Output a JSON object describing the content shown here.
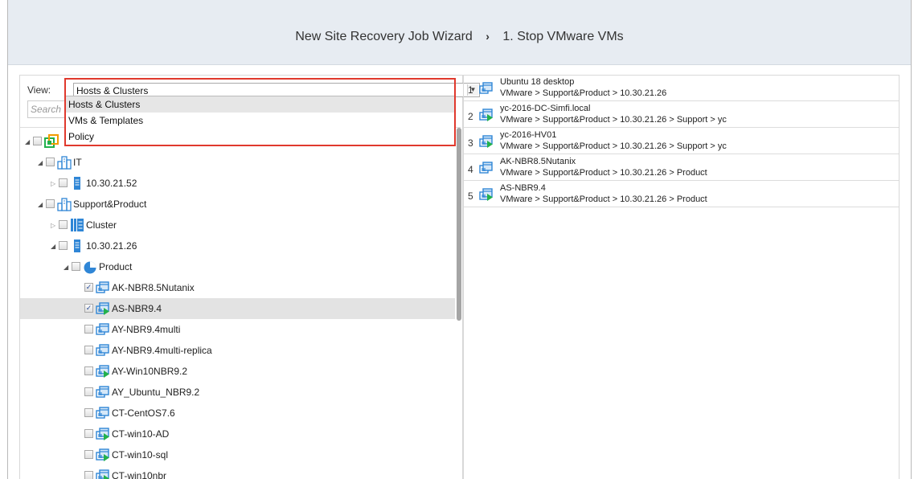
{
  "header": {
    "wizard_title": "New Site Recovery Job Wizard",
    "separator": "›",
    "step_title": "1. Stop VMware VMs"
  },
  "view": {
    "label": "View:",
    "selected": "Hosts & Clusters",
    "options": [
      "Hosts & Clusters",
      "VMs & Templates",
      "Policy"
    ]
  },
  "search": {
    "placeholder": "Search"
  },
  "tree": {
    "rows": [
      {
        "label": "",
        "icon": "vmware-root-icon",
        "twisty": "expanded",
        "checked": false
      },
      {
        "label": "IT",
        "icon": "folder-datacenter-icon",
        "twisty": "expanded",
        "checked": false
      },
      {
        "label": "10.30.21.52",
        "icon": "host-server-icon",
        "twisty": "collapsed",
        "checked": false
      },
      {
        "label": "Support&Product",
        "icon": "folder-datacenter-icon",
        "twisty": "expanded",
        "checked": false
      },
      {
        "label": "Cluster",
        "icon": "cluster-icon",
        "twisty": "collapsed",
        "checked": false
      },
      {
        "label": "10.30.21.26",
        "icon": "host-server-icon",
        "twisty": "expanded",
        "checked": false
      },
      {
        "label": "Product",
        "icon": "resource-pool-icon",
        "twisty": "expanded",
        "checked": false
      },
      {
        "label": "AK-NBR8.5Nutanix",
        "icon": "vm-icon",
        "twisty": "",
        "checked": true
      },
      {
        "label": "AS-NBR9.4",
        "icon": "vm-running-icon",
        "twisty": "",
        "checked": true
      },
      {
        "label": "AY-NBR9.4multi",
        "icon": "vm-icon",
        "twisty": "",
        "checked": false
      },
      {
        "label": "AY-NBR9.4multi-replica",
        "icon": "vm-icon",
        "twisty": "",
        "checked": false
      },
      {
        "label": "AY-Win10NBR9.2",
        "icon": "vm-running-icon",
        "twisty": "",
        "checked": false
      },
      {
        "label": "AY_Ubuntu_NBR9.2",
        "icon": "vm-icon",
        "twisty": "",
        "checked": false
      },
      {
        "label": "CT-CentOS7.6",
        "icon": "vm-icon",
        "twisty": "",
        "checked": false
      },
      {
        "label": "CT-win10-AD",
        "icon": "vm-running-icon",
        "twisty": "",
        "checked": false
      },
      {
        "label": "CT-win10-sql",
        "icon": "vm-running-icon",
        "twisty": "",
        "checked": false
      },
      {
        "label": "CT-win10nbr",
        "icon": "vm-running-icon",
        "twisty": "",
        "checked": false
      }
    ]
  },
  "selected_vms": [
    {
      "index": "1",
      "name": "Ubuntu 18 desktop",
      "path": "VMware > Support&Product > 10.30.21.26",
      "icon": "vm-icon"
    },
    {
      "index": "2",
      "name": "yc-2016-DC-Simfi.local",
      "path": "VMware > Support&Product > 10.30.21.26 > Support > yc",
      "icon": "vm-running-icon"
    },
    {
      "index": "3",
      "name": "yc-2016-HV01",
      "path": "VMware > Support&Product > 10.30.21.26 > Support > yc",
      "icon": "vm-running-icon"
    },
    {
      "index": "4",
      "name": "AK-NBR8.5Nutanix",
      "path": "VMware > Support&Product > 10.30.21.26 > Product",
      "icon": "vm-icon"
    },
    {
      "index": "5",
      "name": "AS-NBR9.4",
      "path": "VMware > Support&Product > 10.30.21.26 > Product",
      "icon": "vm-running-icon"
    }
  ],
  "colors": {
    "header_bg": "#e7ecf2",
    "highlight": "#e0392d",
    "selected_row": "#e3e3e3",
    "icon_blue": "#2f86d6",
    "icon_green": "#22b14c"
  }
}
